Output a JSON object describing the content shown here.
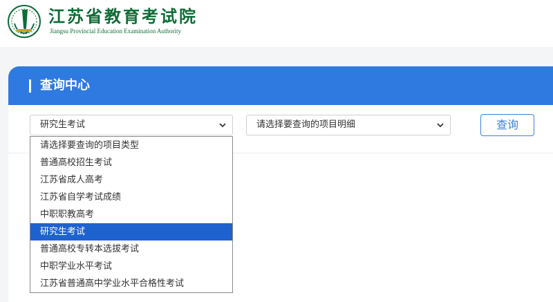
{
  "header": {
    "org_name": "江苏省教育考试院",
    "org_name_en": "Jiangsu Provincial Education Examination Authority"
  },
  "panel": {
    "title": "查询中心"
  },
  "query": {
    "type_select_value": "研究生考试",
    "detail_select_value": "请选择要查询的项目明细",
    "button_label": "查询"
  },
  "dropdown": {
    "options": [
      "请选择要查询的项目类型",
      "普通高校招生考试",
      "江苏省成人高考",
      "江苏省自学考试成绩",
      "中职职教高考",
      "研究生考试",
      "普通高校专转本选拔考试",
      "中职学业水平考试",
      "江苏省普通高中学业水平合格性考试"
    ],
    "selected_index": 5
  },
  "colors": {
    "brand_green": "#0f6b36",
    "header_blue": "#2f7ae0",
    "selection_blue": "#1e62d0",
    "button_blue": "#3d7fd6"
  },
  "icons": {
    "logo": "authority-emblem-icon",
    "select_arrow": "chevron-down-icon"
  }
}
